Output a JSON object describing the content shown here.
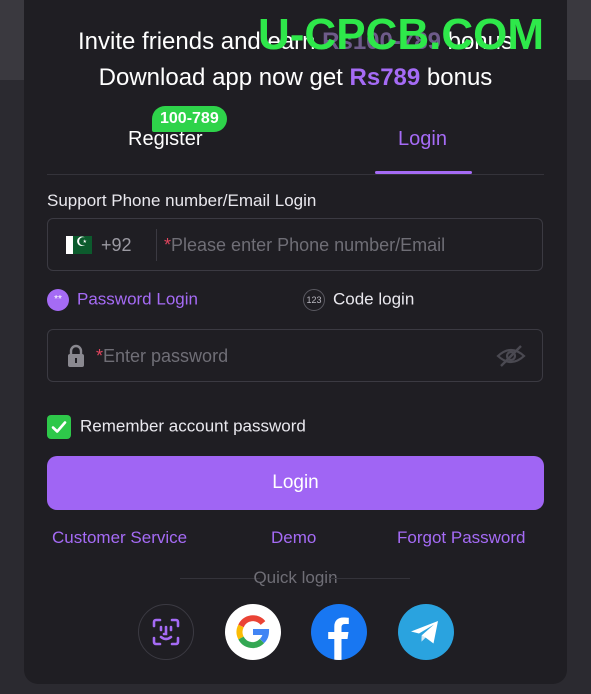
{
  "watermark": "U-CPCB.COM",
  "promo": {
    "line1_prefix": "Invite friends and earn ",
    "line1_amount": "Rs100-789",
    "line1_suffix": " bonus",
    "line2_prefix": "Download app now get ",
    "line2_amount": "Rs789",
    "line2_suffix": " bonus"
  },
  "tabs": {
    "register": "Register",
    "register_badge": "100-789",
    "login": "Login"
  },
  "form": {
    "support_label": "Support Phone number/Email Login",
    "country_code": "+92",
    "required_mark": "*",
    "phone_placeholder": "Please enter Phone number/Email",
    "password_login": "Password Login",
    "code_login": "Code login",
    "code_icon_text": "123",
    "password_placeholder": "Enter password",
    "remember": "Remember account password",
    "login_button": "Login"
  },
  "links": {
    "customer_service": "Customer Service",
    "demo": "Demo",
    "forgot_password": "Forgot Password"
  },
  "quick_login": {
    "label": "Quick login",
    "providers": [
      "face-id",
      "google",
      "facebook",
      "telegram"
    ]
  },
  "colors": {
    "accent": "#a56bf5",
    "button": "#a065f4",
    "badge": "#2ed34a",
    "watermark": "#2ee84a",
    "panel": "#1f1e23"
  }
}
